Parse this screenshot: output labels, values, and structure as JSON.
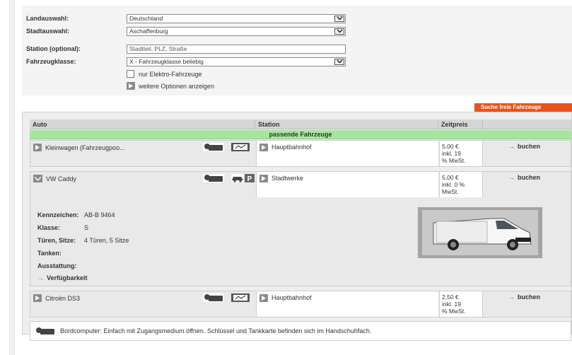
{
  "form": {
    "country_label": "Landauswahl:",
    "country_value": "Deutschland",
    "city_label": "Stadtauswahl:",
    "city_value": "Aschaffenburg",
    "station_label": "Station (optional):",
    "station_placeholder": "Stadtteil, PLZ, Straße",
    "vehicle_class_label": "Fahrzeugklasse:",
    "vehicle_class_value": "X - Fahrzeugklasse beliebig",
    "electric_only_label": "nur Elektro-Fahrzeuge",
    "electric_only_checked": false,
    "more_options_label": "weitere Optionen anzeigen"
  },
  "search_button_label": "Suche freie Fahrzeuge",
  "table": {
    "headers": {
      "auto": "Auto",
      "station": "Station",
      "price": "Zeitpreis"
    },
    "group_label": "passende Fahrzeuge",
    "rows": [
      {
        "vehicle": "Kleinwagen (Fahrzeugpoo...",
        "station": "Hauptbahnhof",
        "price_line1": "5,00 €",
        "price_line2": "inkl. 19",
        "price_line3": "% MwSt.",
        "book_label": "buchen",
        "icons": [
          "key-icon",
          "fuel-card-icon"
        ]
      },
      {
        "vehicle": "VW Caddy",
        "station": "Stadtwerke",
        "price_line1": "5,00 €",
        "price_line2": "inkl. 0 %",
        "price_line3": "MwSt.",
        "book_label": "buchen",
        "icons": [
          "key-icon",
          "car-icon",
          "parking-icon"
        ],
        "expanded": true,
        "details": {
          "plate_label": "Kennzeichen:",
          "plate_value": "AB-B 9464",
          "class_label": "Klasse:",
          "class_value": "S",
          "doors_label": "Türen, Sitze:",
          "doors_value": "4 Türen, 5 Sitze",
          "fuel_label": "Tanken:",
          "equipment_label": "Ausstattung:",
          "availability_label": "Verfügbarkeit"
        }
      },
      {
        "vehicle": "Citroën DS3",
        "station": "Hauptbahnhof",
        "price_line1": "2,50 €",
        "price_line2": "inkl. 19",
        "price_line3": "% MwSt.",
        "book_label": "buchen",
        "icons": [
          "key-icon",
          "fuel-card-icon"
        ]
      }
    ],
    "legend_text": "Bordcomputer: Einfach mit Zugangsmedium öffnen. Schlüssel und Tankkarte befinden sich im Handschuhfach."
  },
  "colors": {
    "accent_orange": "#e8521d",
    "group_green": "#a8e4a0",
    "panel_grey": "#f4f4f4"
  }
}
